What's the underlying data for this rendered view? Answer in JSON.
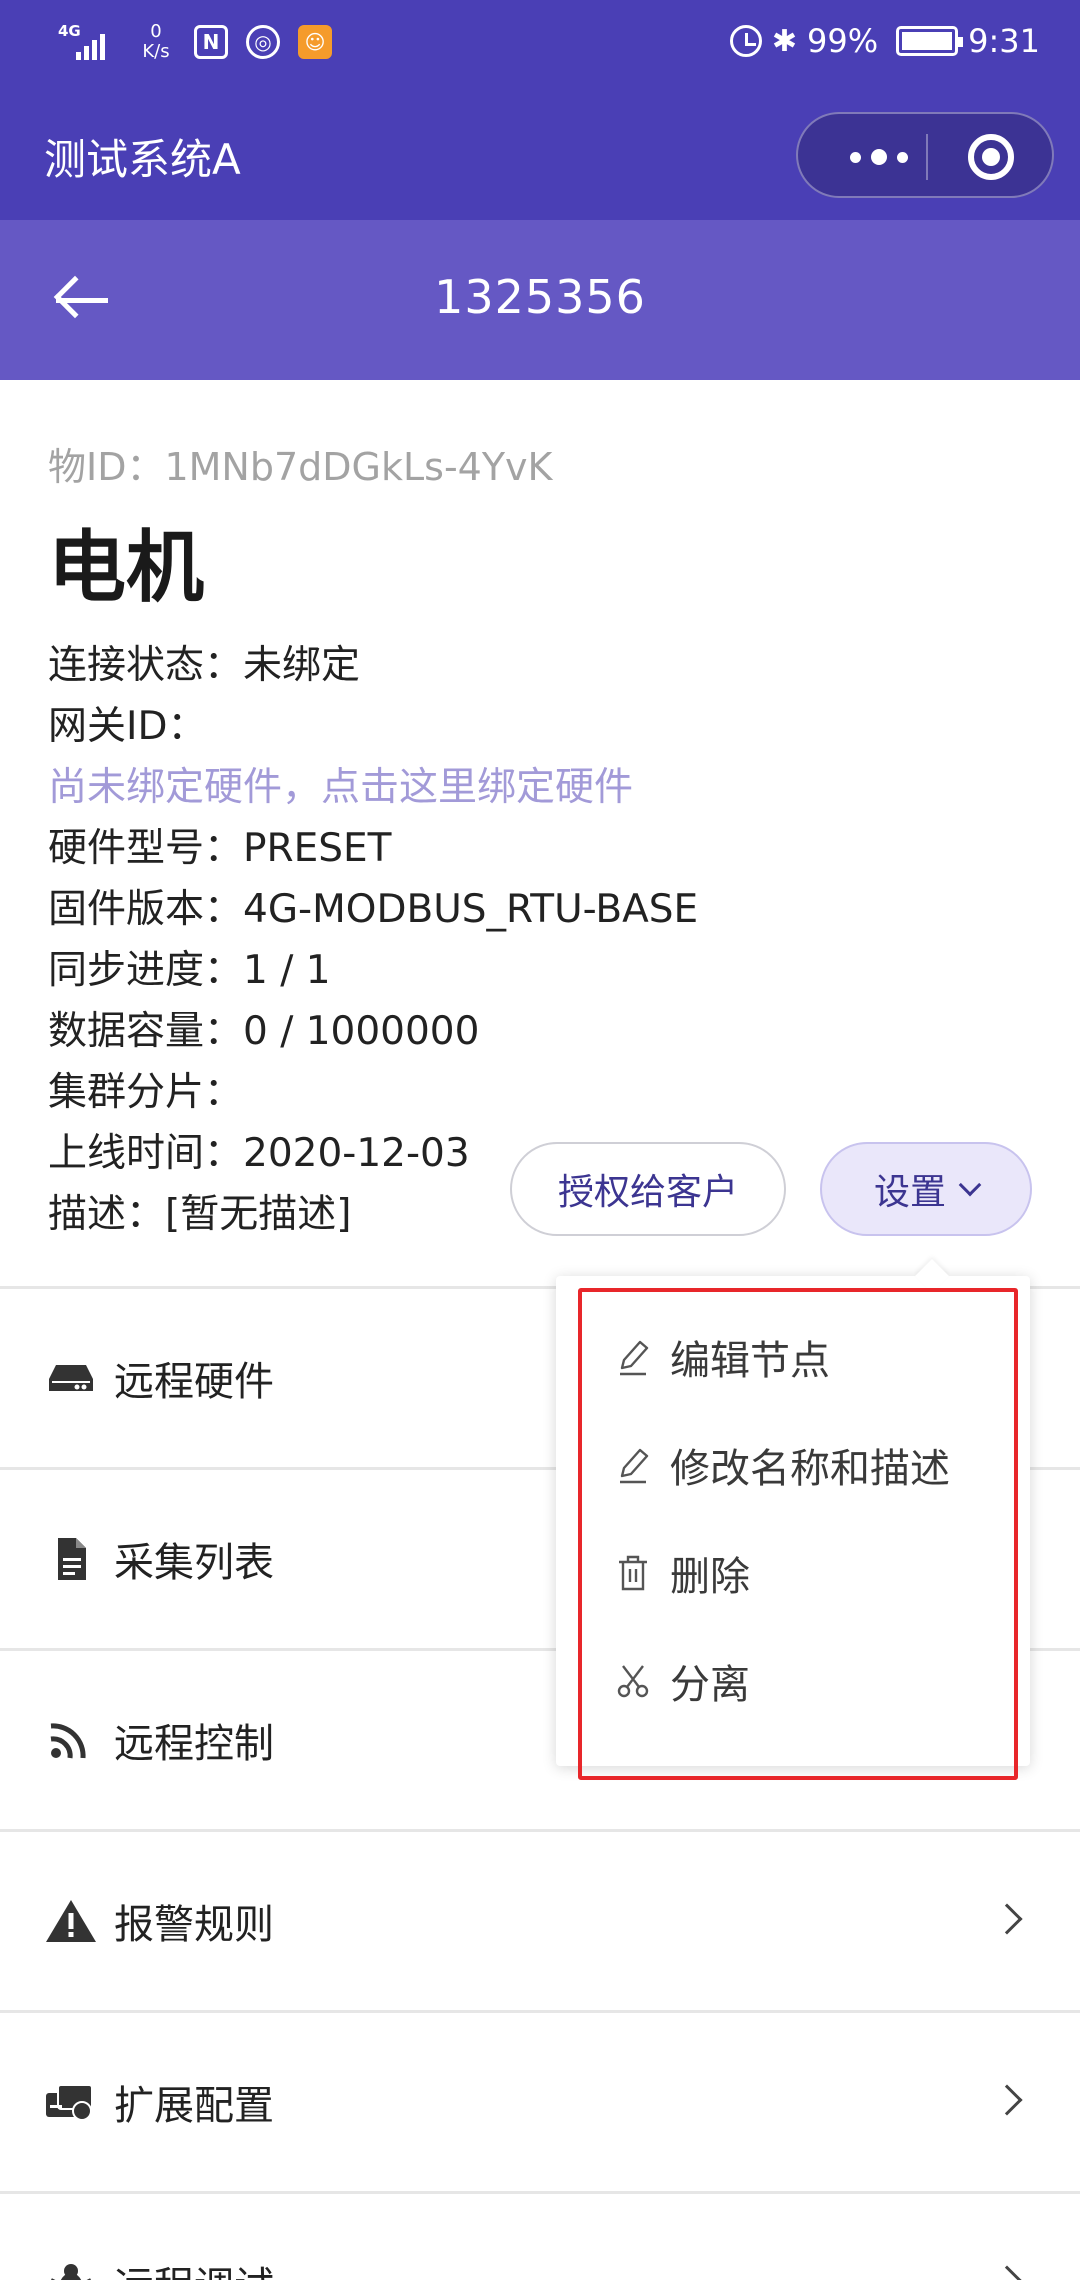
{
  "status_bar": {
    "network": "4G",
    "speed_value": "0",
    "speed_unit": "K/s",
    "nfc_icon": "N",
    "battery_percent": "99%",
    "time": "9:31"
  },
  "app": {
    "title": "测试系统A"
  },
  "nav": {
    "title": "1325356"
  },
  "device": {
    "object_id": "物ID：1MNb7dDGkLs-4YvK",
    "name": "电机",
    "info": {
      "connection": "连接状态：未绑定",
      "gateway": "网关ID：",
      "bind_link": "尚未绑定硬件，点击这里绑定硬件",
      "hardware_model": "硬件型号：PRESET",
      "firmware": "固件版本：4G-MODBUS_RTU-BASE",
      "sync_progress": "同步进度：1 / 1",
      "data_capacity": "数据容量：0 / 1000000",
      "cluster_shard": "集群分片：",
      "online_time": "上线时间：2020-12-03",
      "description": "描述：[暂无描述]"
    }
  },
  "actions": {
    "authorize_label": "授权给客户",
    "settings_label": "设置"
  },
  "settings_menu": {
    "items": [
      {
        "label": "编辑节点",
        "icon": "pencil-icon"
      },
      {
        "label": "修改名称和描述",
        "icon": "pencil-icon"
      },
      {
        "label": "删除",
        "icon": "trash-icon"
      },
      {
        "label": "分离",
        "icon": "scissors-icon"
      }
    ]
  },
  "menu_list": {
    "items": [
      {
        "label": "远程硬件",
        "icon": "hard-drive-icon"
      },
      {
        "label": "采集列表",
        "icon": "document-icon"
      },
      {
        "label": "远程控制",
        "icon": "rss-icon"
      },
      {
        "label": "报警规则",
        "icon": "warning-icon"
      },
      {
        "label": "扩展配置",
        "icon": "config-icon"
      },
      {
        "label": "远程调试",
        "icon": "bug-icon"
      }
    ]
  },
  "colors": {
    "header": "#4a3fb5",
    "nav": "#6558c4",
    "link": "#a29ad8",
    "highlight": "#e8262a"
  }
}
